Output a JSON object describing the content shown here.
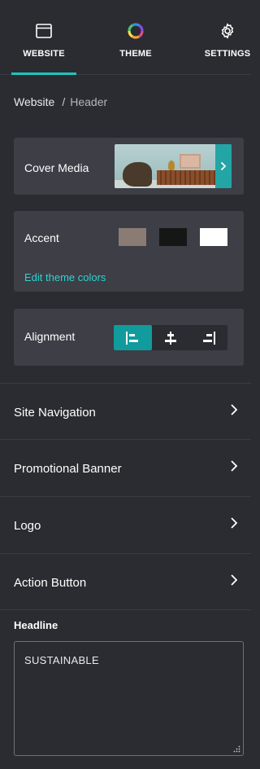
{
  "tabs": [
    {
      "label": "WEBSITE",
      "icon": "browser-window-icon",
      "active": true
    },
    {
      "label": "THEME",
      "icon": "color-wheel-icon",
      "active": false
    },
    {
      "label": "SETTINGS",
      "icon": "gear-icon",
      "active": false
    }
  ],
  "breadcrumb": {
    "root": "Website",
    "separator": "/",
    "current": "Header"
  },
  "cover_media": {
    "label": "Cover Media",
    "icon": "chevron-right-icon"
  },
  "accent": {
    "label": "Accent",
    "swatches": [
      "#8a7c75",
      "#161616",
      "#ffffff"
    ],
    "edit_link": "Edit theme colors"
  },
  "alignment": {
    "label": "Alignment",
    "options": [
      "align-left-icon",
      "align-center-icon",
      "align-right-icon"
    ],
    "selected": "left"
  },
  "nav_rows": [
    {
      "label": "Site Navigation"
    },
    {
      "label": "Promotional Banner"
    },
    {
      "label": "Logo"
    },
    {
      "label": "Action Button"
    }
  ],
  "headline": {
    "label": "Headline",
    "value": "SUSTAINABLE"
  },
  "colors": {
    "accent": "#1dc4c0",
    "panel": "#3d3e46",
    "background": "#2b2c31"
  }
}
